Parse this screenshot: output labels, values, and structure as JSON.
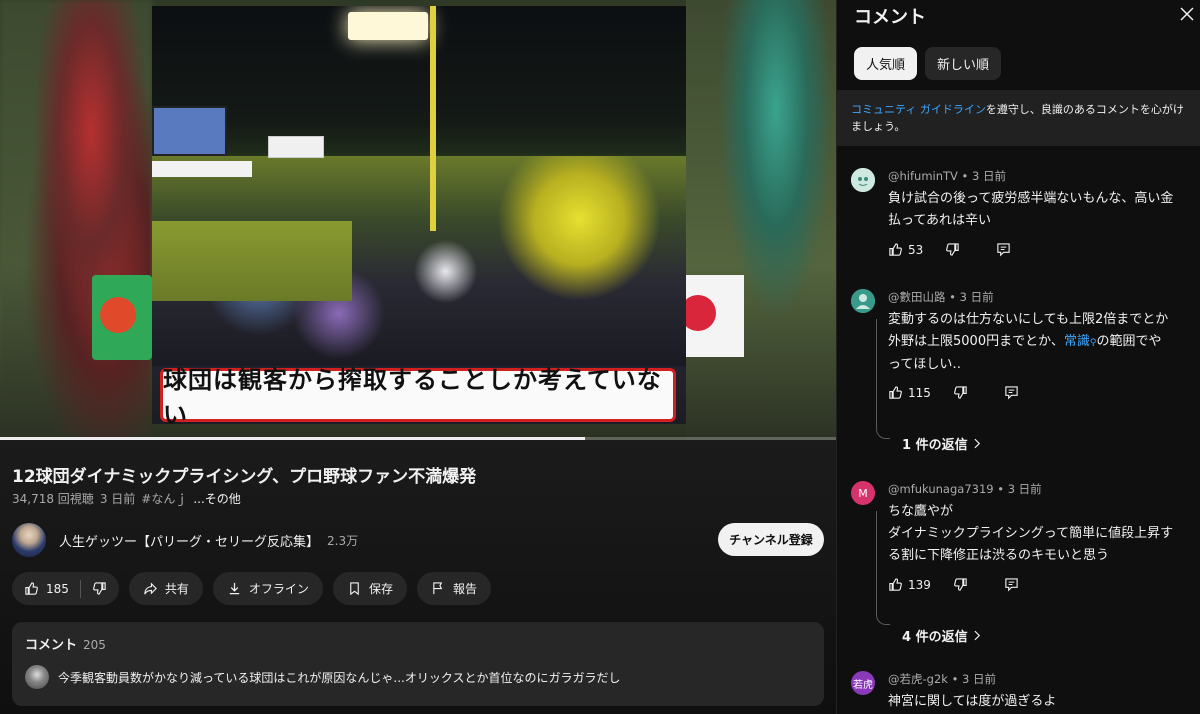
{
  "video": {
    "caption_overlay": "球団は観客から搾取することしか考えていない",
    "progress": 0.7
  },
  "info": {
    "title": "12球団ダイナミックプライシング、プロ野球ファン不満爆発",
    "views": "34,718 回視聴",
    "date": "3 日前",
    "hashtag": "#なんｊ",
    "more": "...その他",
    "channel_name": "人生ゲッツー【パリーグ・セリーグ反応集】",
    "subscribers": "2.3万",
    "subscribe_label": "チャンネル登録",
    "likes": "185",
    "share_label": "共有",
    "offline_label": "オフライン",
    "save_label": "保存",
    "report_label": "報告"
  },
  "comment_box": {
    "label": "コメント",
    "count": "205",
    "preview": "今季観客動員数がかなり減っている球団はこれが原因なんじゃ...オリックスとか首位なのにガラガラだし"
  },
  "panel": {
    "title": "コメント",
    "tabs": [
      "人気順",
      "新しい順"
    ],
    "guideline_link": "コミュニティ ガイドライン",
    "guideline_text_1": "を遵守し、良識のあるコメントを心がけ",
    "guideline_text_2": "ましょう。",
    "comments": [
      {
        "author": "@hifuminTV",
        "time": "3 日前",
        "text_1": "負け試合の後って疲労感半端ないもんな、高い金",
        "text_2": "払ってあれは辛い",
        "likes": "53",
        "avatar_color": "#cfe9e0"
      },
      {
        "author": "@數田山路",
        "time": "3 日前",
        "text_1": "変動するのは仕方ないにしても上限2倍までとか",
        "text_2a": "外野は上限5000円までとか、",
        "text_link": "常識",
        "text_2b": "の範囲でや",
        "text_3": "ってほしい‥",
        "likes": "115",
        "replies": "1 件の返信",
        "avatar_color": "#3a9a8a"
      },
      {
        "author": "@mfukunaga7319",
        "time": "3 日前",
        "text_1": "ちな鷹やが",
        "text_2": "ダイナミックプライシングって簡単に値段上昇す",
        "text_3": "る割に下降修正は渋るのキモいと思う",
        "likes": "139",
        "replies": "4 件の返信",
        "avatar_letter": "M",
        "avatar_color": "#d6336c"
      },
      {
        "author": "@若虎-g2k",
        "time": "3 日前",
        "text_1": "神宮に関しては度が過ぎるよ",
        "avatar_letter": "若虎",
        "avatar_color": "#8a3ab8"
      }
    ]
  }
}
